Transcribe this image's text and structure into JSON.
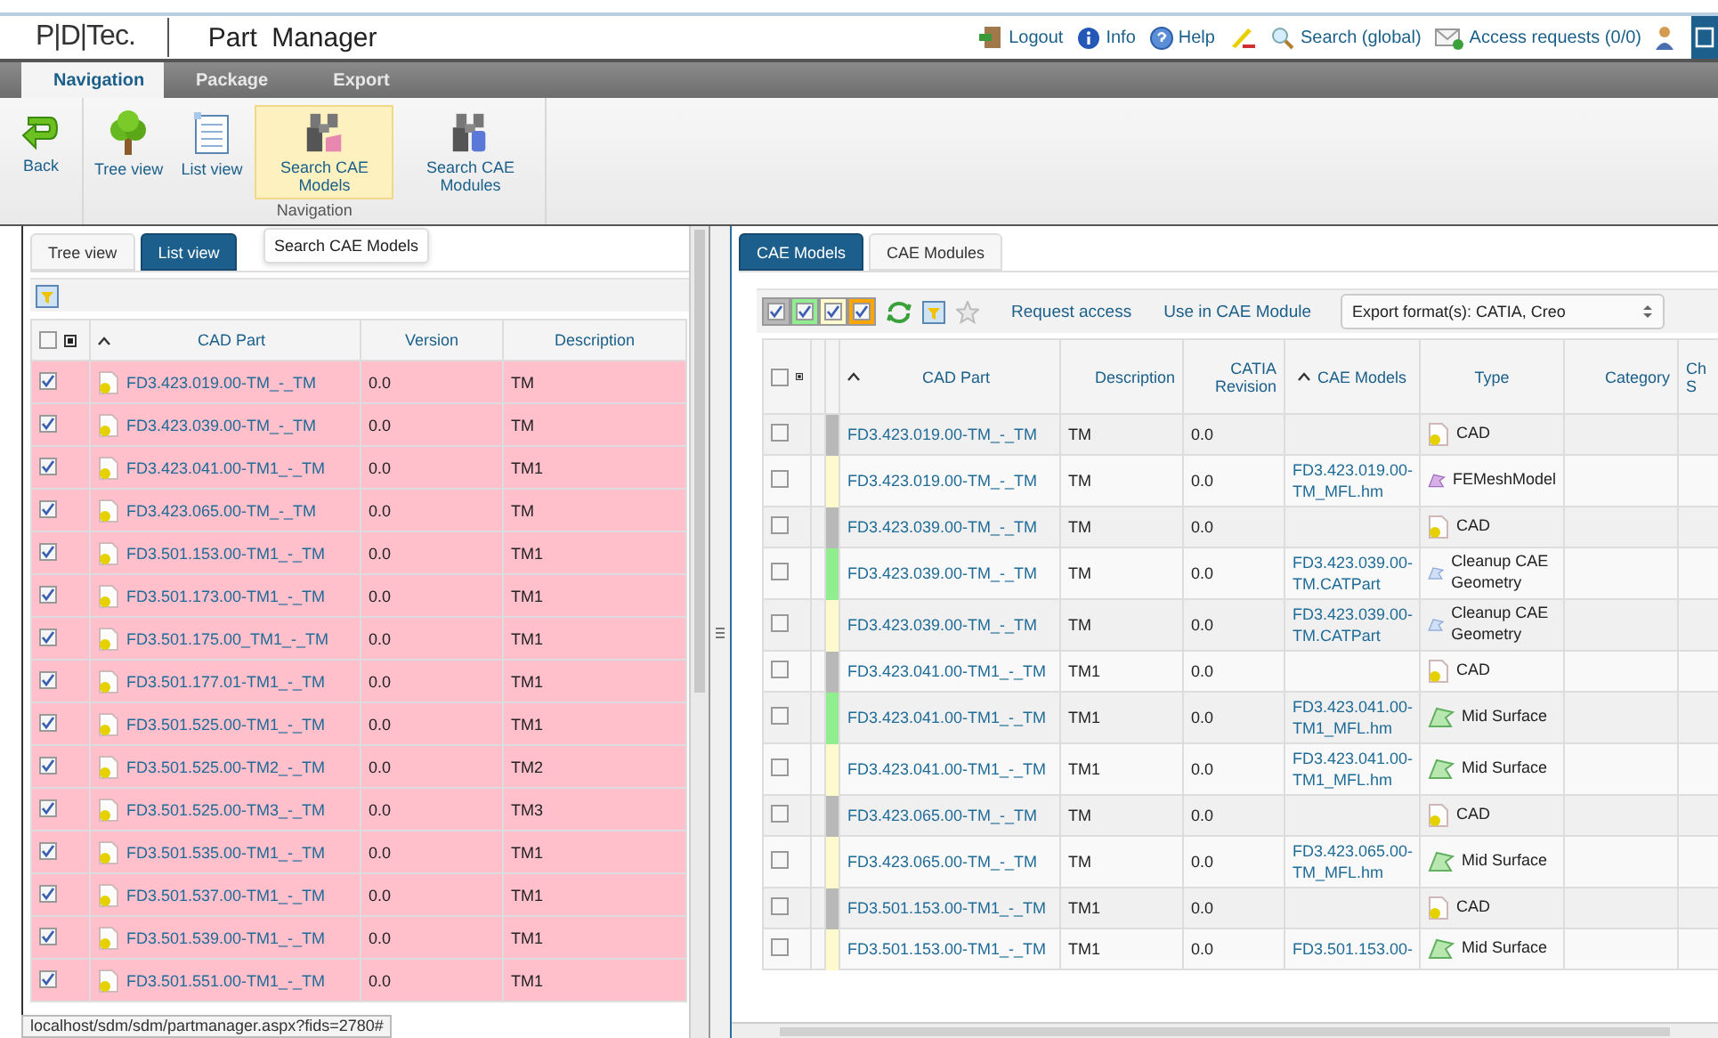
{
  "header": {
    "logo": "P|D|Tec.",
    "title": "Part Manager",
    "links": [
      {
        "kind": "logout",
        "label": "Logout"
      },
      {
        "kind": "info",
        "label": "Info"
      },
      {
        "kind": "help",
        "label": "Help"
      },
      {
        "kind": "pen"
      },
      {
        "kind": "search",
        "label": "Search (global)"
      },
      {
        "kind": "mail",
        "label": "Access requests (0/0)"
      },
      {
        "kind": "user"
      }
    ]
  },
  "ribbon": {
    "tabs": [
      {
        "label": "Navigation",
        "selected": true
      },
      {
        "label": "Package",
        "selected": false
      },
      {
        "label": "Export",
        "selected": false
      }
    ],
    "groups": [
      {
        "buttons": [
          {
            "kind": "back",
            "label": "Back",
            "selected": false
          }
        ]
      },
      {
        "label": "Navigation",
        "buttons": [
          {
            "kind": "tree",
            "label": "Tree view",
            "selected": false
          },
          {
            "kind": "list",
            "label": "List view",
            "selected": false
          },
          {
            "kind": "models",
            "label": "Search CAE Models",
            "selected": true
          },
          {
            "kind": "modules",
            "label": "Search CAE Modules",
            "selected": false
          }
        ]
      }
    ]
  },
  "left": {
    "tabs": [
      {
        "label": "Tree view",
        "selected": false
      },
      {
        "label": "List view",
        "selected": true
      }
    ],
    "tooltip": "Search CAE Models",
    "table": {
      "all_checked": false,
      "columns": [
        "CAD Part",
        "Version",
        "Description"
      ],
      "rows": [
        {
          "checked": true,
          "cad_part": "FD3.423.019.00-TM_-_TM",
          "version": "0.0",
          "description": "TM"
        },
        {
          "checked": true,
          "cad_part": "FD3.423.039.00-TM_-_TM",
          "version": "0.0",
          "description": "TM"
        },
        {
          "checked": true,
          "cad_part": "FD3.423.041.00-TM1_-_TM",
          "version": "0.0",
          "description": "TM1"
        },
        {
          "checked": true,
          "cad_part": "FD3.423.065.00-TM_-_TM",
          "version": "0.0",
          "description": "TM"
        },
        {
          "checked": true,
          "cad_part": "FD3.501.153.00-TM1_-_TM",
          "version": "0.0",
          "description": "TM1"
        },
        {
          "checked": true,
          "cad_part": "FD3.501.173.00-TM1_-_TM",
          "version": "0.0",
          "description": "TM1"
        },
        {
          "checked": true,
          "cad_part": "FD3.501.175.00_TM1_-_TM",
          "version": "0.0",
          "description": "TM1"
        },
        {
          "checked": true,
          "cad_part": "FD3.501.177.01-TM1_-_TM",
          "version": "0.0",
          "description": "TM1"
        },
        {
          "checked": true,
          "cad_part": "FD3.501.525.00-TM1_-_TM",
          "version": "0.0",
          "description": "TM1"
        },
        {
          "checked": true,
          "cad_part": "FD3.501.525.00-TM2_-_TM",
          "version": "0.0",
          "description": "TM2"
        },
        {
          "checked": true,
          "cad_part": "FD3.501.525.00-TM3_-_TM",
          "version": "0.0",
          "description": "TM3"
        },
        {
          "checked": true,
          "cad_part": "FD3.501.535.00-TM1_-_TM",
          "version": "0.0",
          "description": "TM1"
        },
        {
          "checked": true,
          "cad_part": "FD3.501.537.00-TM1_-_TM",
          "version": "0.0",
          "description": "TM1"
        },
        {
          "checked": true,
          "cad_part": "FD3.501.539.00-TM1_-_TM",
          "version": "0.0",
          "description": "TM1"
        },
        {
          "checked": true,
          "cad_part": "FD3.501.551.00-TM1_-_TM",
          "version": "0.0",
          "description": "TM1"
        }
      ]
    }
  },
  "right": {
    "tabs": [
      {
        "label": "CAE Models",
        "selected": true
      },
      {
        "label": "CAE Modules",
        "selected": false
      }
    ],
    "legend": [
      {
        "color": "#b8b8b8",
        "checked": true
      },
      {
        "color": "#90ee90",
        "checked": true
      },
      {
        "color": "#fffacd",
        "checked": true
      },
      {
        "color": "#ffa500",
        "checked": true
      }
    ],
    "actions": [
      "Request access",
      "Use in CAE Module"
    ],
    "export_select": "Export format(s): CATIA, Creo",
    "table": {
      "all_checked": false,
      "columns": [
        "CAD Part",
        "Description",
        "CATIA Revision",
        "CAE Models",
        "Type",
        "Category",
        "Ch S"
      ],
      "rows": [
        {
          "checked": false,
          "color": "#b8b8b8",
          "cad_part": "FD3.423.019.00-TM_-_TM",
          "description": "TM",
          "revision": "0.0",
          "cae_model": "",
          "type": {
            "kind": "cad",
            "label": "CAD"
          }
        },
        {
          "checked": false,
          "color": "#fffacd",
          "cad_part": "FD3.423.019.00-TM_-_TM",
          "description": "TM",
          "revision": "0.0",
          "cae_model": "FD3.423.019.00-TM_MFL.hm",
          "type": {
            "kind": "mesh",
            "label": "FEMeshModel"
          }
        },
        {
          "checked": false,
          "color": "#b8b8b8",
          "cad_part": "FD3.423.039.00-TM_-_TM",
          "description": "TM",
          "revision": "0.0",
          "cae_model": "",
          "type": {
            "kind": "cad",
            "label": "CAD"
          }
        },
        {
          "checked": false,
          "color": "#90ee90",
          "cad_part": "FD3.423.039.00-TM_-_TM",
          "description": "TM",
          "revision": "0.0",
          "cae_model": "FD3.423.039.00-TM.CATPart",
          "type": {
            "kind": "cleanup",
            "label": "Cleanup CAE Geometry"
          }
        },
        {
          "checked": false,
          "color": "#fffacd",
          "cad_part": "FD3.423.039.00-TM_-_TM",
          "description": "TM",
          "revision": "0.0",
          "cae_model": "FD3.423.039.00-TM.CATPart",
          "type": {
            "kind": "cleanup",
            "label": "Cleanup CAE Geometry"
          }
        },
        {
          "checked": false,
          "color": "#b8b8b8",
          "cad_part": "FD3.423.041.00-TM1_-_TM",
          "description": "TM1",
          "revision": "0.0",
          "cae_model": "",
          "type": {
            "kind": "cad",
            "label": "CAD"
          }
        },
        {
          "checked": false,
          "color": "#90ee90",
          "cad_part": "FD3.423.041.00-TM1_-_TM",
          "description": "TM1",
          "revision": "0.0",
          "cae_model": "FD3.423.041.00-TM1_MFL.hm",
          "type": {
            "kind": "mid",
            "label": "Mid Surface"
          }
        },
        {
          "checked": false,
          "color": "#fffacd",
          "cad_part": "FD3.423.041.00-TM1_-_TM",
          "description": "TM1",
          "revision": "0.0",
          "cae_model": "FD3.423.041.00-TM1_MFL.hm",
          "type": {
            "kind": "mid",
            "label": "Mid Surface"
          }
        },
        {
          "checked": false,
          "color": "#b8b8b8",
          "cad_part": "FD3.423.065.00-TM_-_TM",
          "description": "TM",
          "revision": "0.0",
          "cae_model": "",
          "type": {
            "kind": "cad",
            "label": "CAD"
          }
        },
        {
          "checked": false,
          "color": "#fffacd",
          "cad_part": "FD3.423.065.00-TM_-_TM",
          "description": "TM",
          "revision": "0.0",
          "cae_model": "FD3.423.065.00-TM_MFL.hm",
          "type": {
            "kind": "mid",
            "label": "Mid Surface"
          }
        },
        {
          "checked": false,
          "color": "#b8b8b8",
          "cad_part": "FD3.501.153.00-TM1_-_TM",
          "description": "TM1",
          "revision": "0.0",
          "cae_model": "",
          "type": {
            "kind": "cad",
            "label": "CAD"
          }
        },
        {
          "checked": false,
          "color": "#fffacd",
          "cad_part": "FD3.501.153.00-TM1_-_TM",
          "description": "TM1",
          "revision": "0.0",
          "cae_model": "FD3.501.153.00-",
          "type": {
            "kind": "mid",
            "label": "Mid Surface"
          }
        }
      ]
    }
  },
  "status_url": "localhost/sdm/sdm/partmanager.aspx?fids=2780#"
}
